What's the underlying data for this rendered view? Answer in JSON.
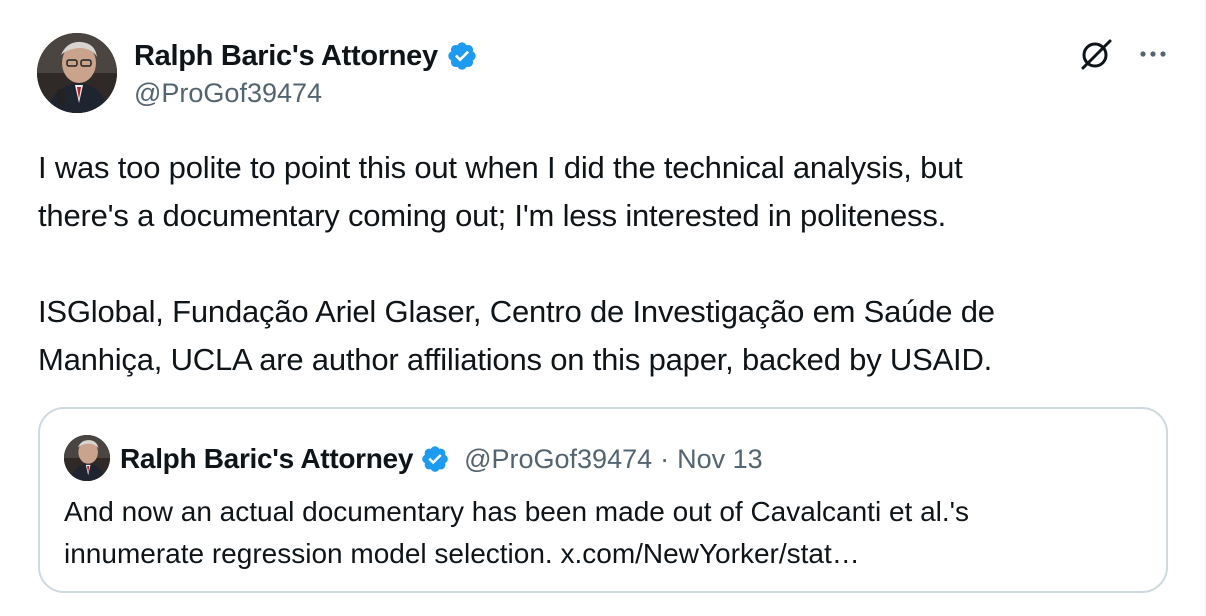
{
  "author": {
    "display_name": "Ralph Baric's Attorney",
    "handle": "@ProGof39474",
    "verified_icon": "verified-badge-icon",
    "avatar_icon": "avatar"
  },
  "header_actions": {
    "grok_icon": "grok-icon",
    "more_icon": "more-icon"
  },
  "tweet": {
    "paragraph_1": "I was too polite to point this out when I did the technical analysis, but\nthere's a documentary coming out; I'm less interested in politeness.",
    "paragraph_2": "ISGlobal, Fundação Ariel Glaser, Centro de Investigação em Saúde de\nManhiça, UCLA are author affiliations on this paper, backed by USAID."
  },
  "quote": {
    "display_name": "Ralph Baric's Attorney",
    "handle": "@ProGof39474",
    "separator": "·",
    "date": "Nov 13",
    "text": "And now an actual documentary has been made out of Cavalcanti et al.'s\ninnumerate regression model selection. x.com/NewYorker/stat…"
  },
  "colors": {
    "text_primary": "#0f1419",
    "text_secondary": "#536471",
    "verified_blue": "#1d9bf0",
    "border": "#cfd9de"
  }
}
